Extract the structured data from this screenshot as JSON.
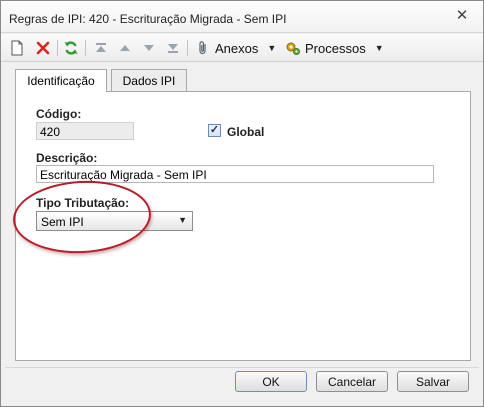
{
  "window": {
    "title": "Regras de IPI: 420 - Escrituração Migrada - Sem IPI",
    "close_glyph": "✕"
  },
  "toolbar": {
    "anexos_label": "Anexos",
    "processos_label": "Processos",
    "icons": [
      "new-document-icon",
      "delete-icon",
      "refresh-icon",
      "move-first-icon",
      "move-up-icon",
      "move-down-icon",
      "move-last-icon",
      "paperclip-icon",
      "gears-icon"
    ],
    "colors": {
      "delete": "#d9261c",
      "refresh": "#2f9a2f",
      "disabled": "#9aa4ae"
    }
  },
  "tabs": [
    {
      "label": "Identificação",
      "active": true
    },
    {
      "label": "Dados IPI",
      "active": false
    }
  ],
  "form": {
    "codigo_label": "Código:",
    "codigo_value": "420",
    "global_label": "Global",
    "global_checked": true,
    "descricao_label": "Descrição:",
    "descricao_value": "Escrituração Migrada - Sem IPI",
    "tipo_label": "Tipo Tributação:",
    "tipo_value": "Sem IPI"
  },
  "buttons": {
    "ok": "OK",
    "cancelar": "Cancelar",
    "salvar": "Salvar"
  },
  "annotation_color": "#b31f2c"
}
